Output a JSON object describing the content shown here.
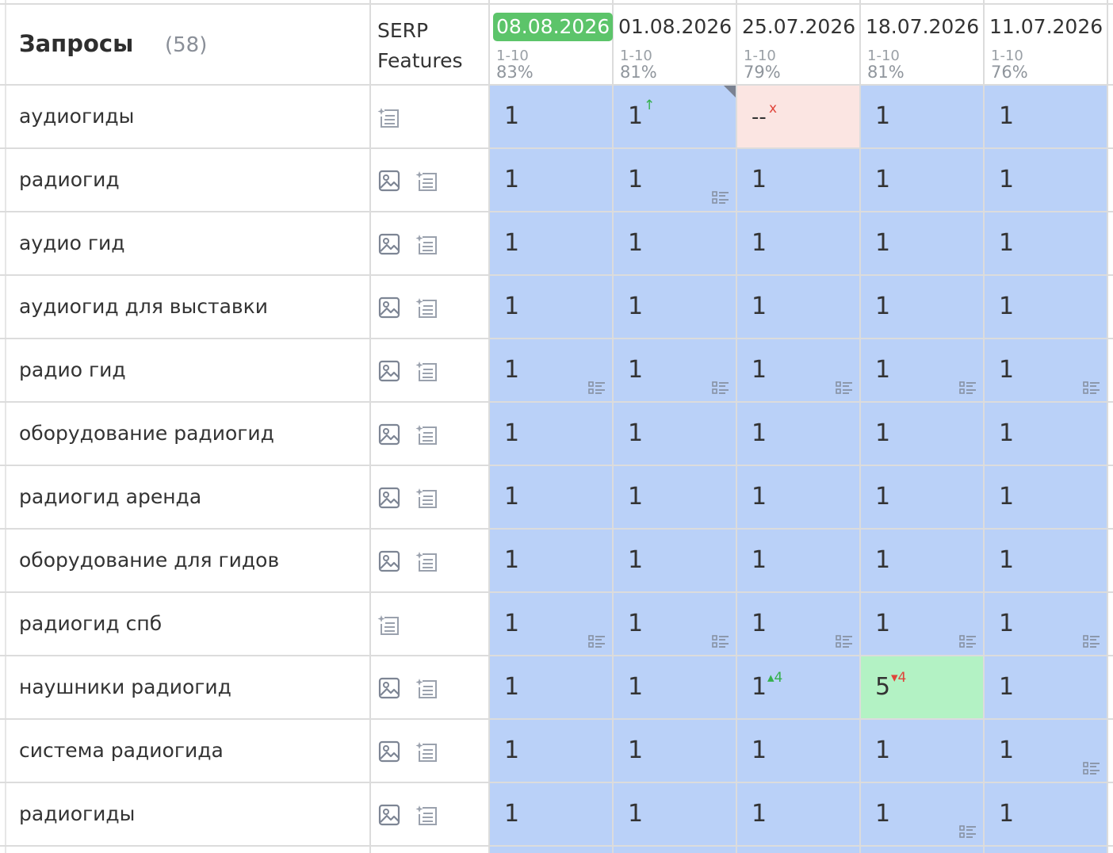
{
  "header": {
    "title": "Запросы",
    "count": "(58)",
    "serp_features": "SERP Features"
  },
  "dates": [
    {
      "label": "08.08.2026",
      "range": "1-10",
      "percent": "83%",
      "active": true
    },
    {
      "label": "01.08.2026",
      "range": "1-10",
      "percent": "81%",
      "active": false
    },
    {
      "label": "25.07.2026",
      "range": "1-10",
      "percent": "79%",
      "active": false
    },
    {
      "label": "18.07.2026",
      "range": "1-10",
      "percent": "81%",
      "active": false
    },
    {
      "label": "11.07.2026",
      "range": "1-10",
      "percent": "76%",
      "active": false
    }
  ],
  "rows": [
    {
      "query": "аудиогиды",
      "features": [
        "serp-list-icon"
      ],
      "cells": [
        {
          "value": "1"
        },
        {
          "value": "1",
          "change": "↑",
          "trend": "up",
          "corner": true
        },
        {
          "value": "--",
          "change": "x",
          "trend": "err",
          "style": "pink"
        },
        {
          "value": "1"
        },
        {
          "value": "1"
        }
      ]
    },
    {
      "query": "радиогид",
      "features": [
        "image-icon",
        "serp-list-icon"
      ],
      "cells": [
        {
          "value": "1"
        },
        {
          "value": "1",
          "snippet": true
        },
        {
          "value": "1"
        },
        {
          "value": "1"
        },
        {
          "value": "1"
        }
      ]
    },
    {
      "query": "аудио гид",
      "features": [
        "image-icon",
        "serp-list-icon"
      ],
      "cells": [
        {
          "value": "1"
        },
        {
          "value": "1"
        },
        {
          "value": "1"
        },
        {
          "value": "1"
        },
        {
          "value": "1"
        }
      ]
    },
    {
      "query": "аудиогид для выставки",
      "features": [
        "image-icon",
        "serp-list-icon"
      ],
      "cells": [
        {
          "value": "1"
        },
        {
          "value": "1"
        },
        {
          "value": "1"
        },
        {
          "value": "1"
        },
        {
          "value": "1"
        }
      ]
    },
    {
      "query": "радио гид",
      "features": [
        "image-icon",
        "serp-list-icon"
      ],
      "cells": [
        {
          "value": "1",
          "snippet": true
        },
        {
          "value": "1",
          "snippet": true
        },
        {
          "value": "1",
          "snippet": true
        },
        {
          "value": "1",
          "snippet": true
        },
        {
          "value": "1",
          "snippet": true
        }
      ]
    },
    {
      "query": "оборудование радиогид",
      "features": [
        "image-icon",
        "serp-list-icon"
      ],
      "cells": [
        {
          "value": "1"
        },
        {
          "value": "1"
        },
        {
          "value": "1"
        },
        {
          "value": "1"
        },
        {
          "value": "1"
        }
      ]
    },
    {
      "query": "радиогид аренда",
      "features": [
        "image-icon",
        "serp-list-icon"
      ],
      "cells": [
        {
          "value": "1"
        },
        {
          "value": "1"
        },
        {
          "value": "1"
        },
        {
          "value": "1"
        },
        {
          "value": "1"
        }
      ]
    },
    {
      "query": "оборудование для гидов",
      "features": [
        "image-icon",
        "serp-list-icon"
      ],
      "cells": [
        {
          "value": "1"
        },
        {
          "value": "1"
        },
        {
          "value": "1"
        },
        {
          "value": "1"
        },
        {
          "value": "1"
        }
      ]
    },
    {
      "query": "радиогид спб",
      "features": [
        "serp-list-icon"
      ],
      "cells": [
        {
          "value": "1",
          "snippet": true
        },
        {
          "value": "1",
          "snippet": true
        },
        {
          "value": "1",
          "snippet": true
        },
        {
          "value": "1",
          "snippet": true
        },
        {
          "value": "1",
          "snippet": true
        }
      ]
    },
    {
      "query": "наушники радиогид",
      "features": [
        "image-icon",
        "serp-list-icon"
      ],
      "cells": [
        {
          "value": "1"
        },
        {
          "value": "1"
        },
        {
          "value": "1",
          "change": "▴4",
          "trend": "up"
        },
        {
          "value": "5",
          "change": "▾4",
          "trend": "down",
          "style": "green"
        },
        {
          "value": "1"
        }
      ]
    },
    {
      "query": "система радиогида",
      "features": [
        "image-icon",
        "serp-list-icon"
      ],
      "cells": [
        {
          "value": "1"
        },
        {
          "value": "1"
        },
        {
          "value": "1"
        },
        {
          "value": "1"
        },
        {
          "value": "1",
          "snippet": true
        }
      ]
    },
    {
      "query": "радиогиды",
      "features": [
        "image-icon",
        "serp-list-icon"
      ],
      "cells": [
        {
          "value": "1"
        },
        {
          "value": "1"
        },
        {
          "value": "1"
        },
        {
          "value": "1",
          "snippet": true
        },
        {
          "value": "1"
        }
      ]
    }
  ],
  "colors": {
    "cell_blue": "#bad1f8",
    "cell_pink": "#fbe5e2",
    "cell_green": "#b3f2c4",
    "active_date": "#5cc46a",
    "up": "#35b04d",
    "down": "#e0443a"
  }
}
